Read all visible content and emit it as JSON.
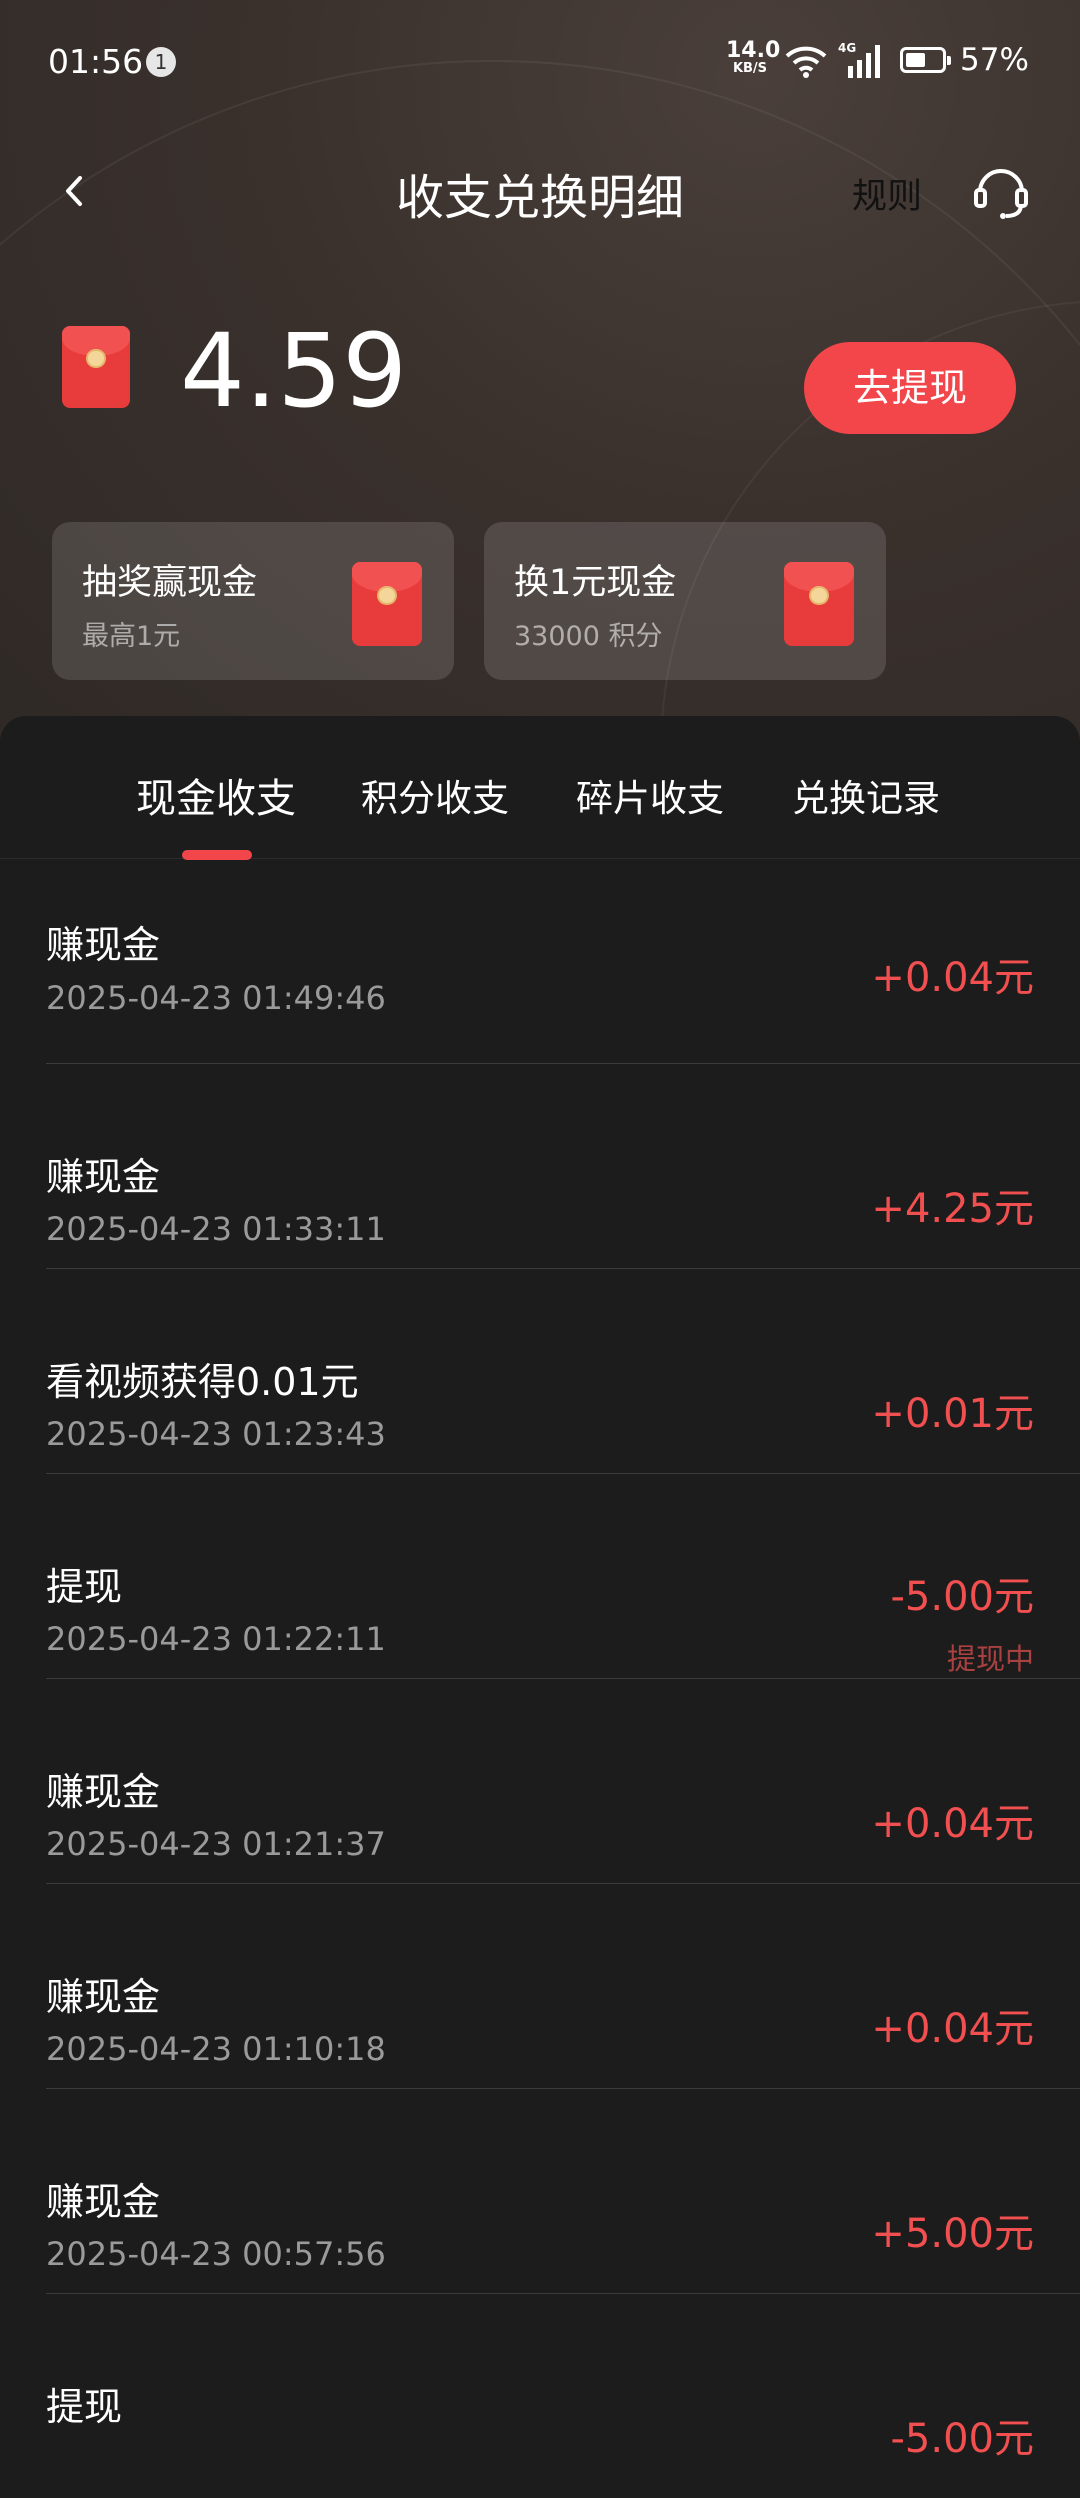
{
  "status_bar": {
    "time": "01:56",
    "notification_count": "1",
    "net_speed_value": "14.0",
    "net_speed_unit": "KB/S",
    "battery_percent": "57%",
    "battery_level": 0.57
  },
  "header": {
    "title": "收支兑换明细",
    "rules_label": "规则",
    "back_icon": "chevron-left-icon",
    "support_icon": "headset-icon"
  },
  "balance": {
    "amount": "4.59",
    "withdraw_label": "去提现"
  },
  "cards": [
    {
      "title": "抽奖赢现金",
      "subtitle": "最高1元"
    },
    {
      "title": "换1元现金",
      "subtitle": "33000 积分"
    }
  ],
  "tabs": [
    {
      "label": "现金收支",
      "active": true
    },
    {
      "label": "积分收支",
      "active": false
    },
    {
      "label": "碎片收支",
      "active": false
    },
    {
      "label": "兑换记录",
      "active": false
    }
  ],
  "transactions": [
    {
      "title": "赚现金",
      "time": "2025-04-23 01:49:46",
      "amount": "+0.04元",
      "status": ""
    },
    {
      "title": "赚现金",
      "time": "2025-04-23 01:33:11",
      "amount": "+4.25元",
      "status": ""
    },
    {
      "title": "看视频获得0.01元",
      "time": "2025-04-23 01:23:43",
      "amount": "+0.01元",
      "status": ""
    },
    {
      "title": "提现",
      "time": "2025-04-23 01:22:11",
      "amount": "-5.00元",
      "status": "提现中"
    },
    {
      "title": "赚现金",
      "time": "2025-04-23 01:21:37",
      "amount": "+0.04元",
      "status": ""
    },
    {
      "title": "赚现金",
      "time": "2025-04-23 01:10:18",
      "amount": "+0.04元",
      "status": ""
    },
    {
      "title": "赚现金",
      "time": "2025-04-23 00:57:56",
      "amount": "+5.00元",
      "status": ""
    },
    {
      "title": "提现",
      "time": "",
      "amount": "-5.00元",
      "status": ""
    }
  ],
  "colors": {
    "accent": "#f2464b",
    "amount_text": "#f25050",
    "background": "#1c1c1c"
  }
}
